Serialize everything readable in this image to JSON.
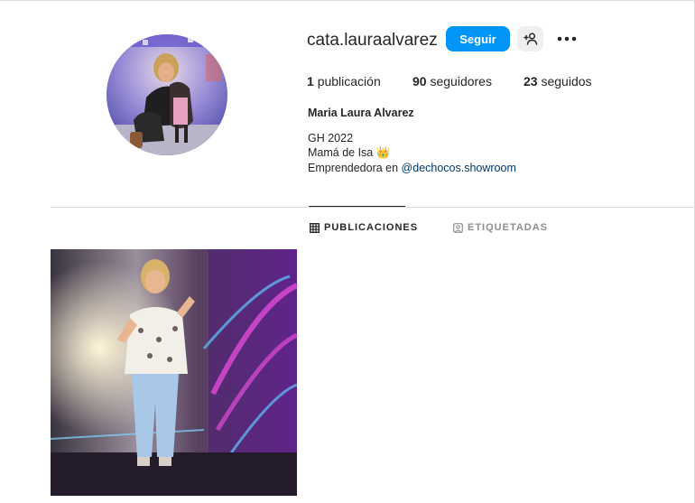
{
  "profile": {
    "username": "cata.lauraalvarez",
    "full_name": "Maria Laura Alvarez",
    "bio_lines": [
      "GH 2022",
      "Mamá de Isa 👑"
    ],
    "bio_link_prefix": "Emprendedora en ",
    "bio_link": "@dechocos.showroom",
    "avatar_icon": "profile-photo"
  },
  "actions": {
    "follow_label": "Seguir",
    "suggest_icon": "add-person-icon",
    "more_icon": "more-options-icon"
  },
  "stats": {
    "posts_count": "1",
    "posts_label": "publicación",
    "followers_count": "90",
    "followers_label": "seguidores",
    "following_count": "23",
    "following_label": "seguidos"
  },
  "tabs": [
    {
      "label": "PUBLICACIONES",
      "icon": "grid-icon",
      "active": true
    },
    {
      "label": "ETIQUETADAS",
      "icon": "tagged-icon",
      "active": false
    }
  ],
  "colors": {
    "primary": "#0095f6",
    "link": "#00376b",
    "border": "#dbdbdb",
    "muted": "#8e8e8e"
  }
}
